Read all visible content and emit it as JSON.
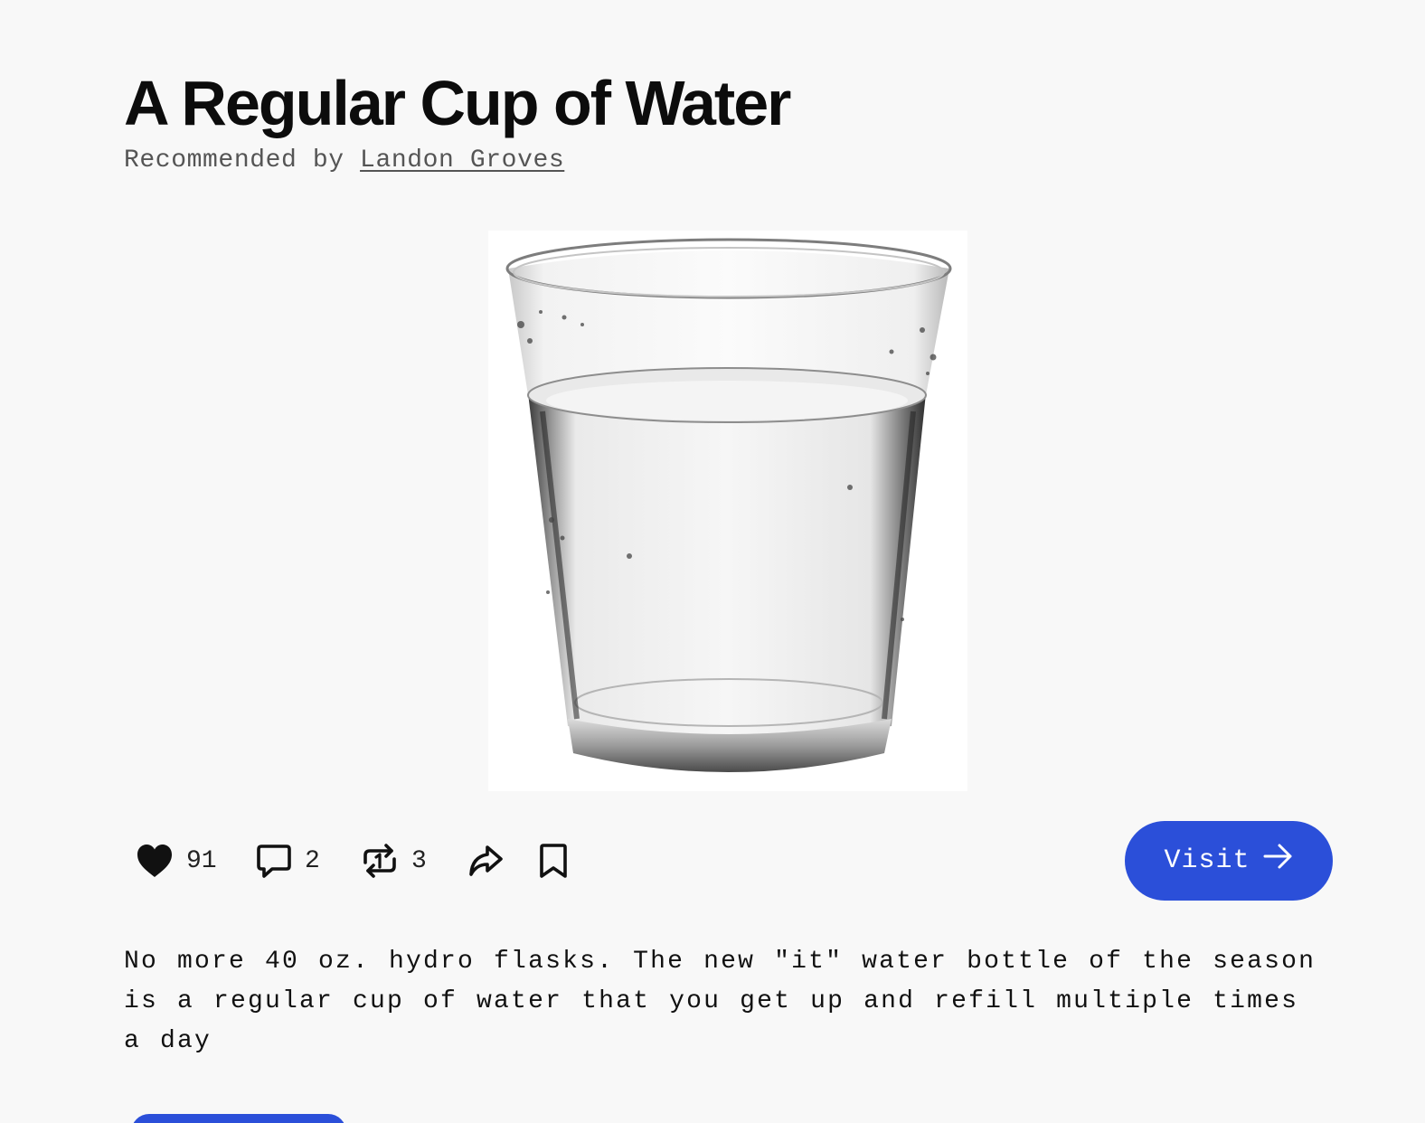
{
  "item": {
    "title": "A Regular Cup of Water",
    "recommended_prefix": "Recommended by",
    "recommender_name": "Landon Groves"
  },
  "image": {
    "alt": "Glass of water"
  },
  "actions": {
    "likes_count": "91",
    "comments_count": "2",
    "reposts_count": "3"
  },
  "visit_button": {
    "label": "Visit"
  },
  "description": "No more 40 oz. hydro flasks. The new \"it\" water bottle of the season is a regular cup of water that you get up and refill multiple times a day",
  "colors": {
    "accent": "#2b4fd9",
    "background": "#f8f8f8",
    "text": "#111111",
    "muted_text": "#555555"
  },
  "icons": {
    "like": "heart-icon",
    "comment": "comment-bubble-icon",
    "repost": "repost-icon",
    "share": "share-arrow-icon",
    "save": "bookmark-icon",
    "visit": "arrow-right-icon"
  }
}
